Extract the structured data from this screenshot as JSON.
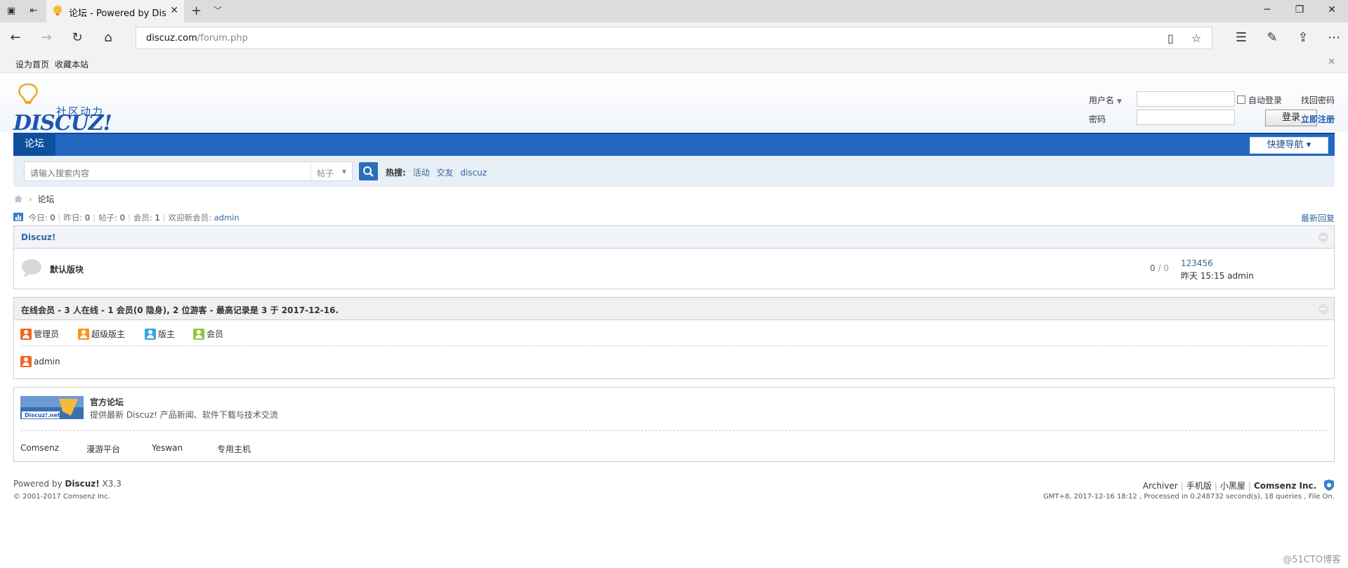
{
  "browser": {
    "tab_title": "论坛 - Powered by Discuz!",
    "url_host": "discuz.com",
    "url_path": "/forum.php",
    "favorites": [
      "设为首页",
      "收藏本站"
    ]
  },
  "header": {
    "slogan": "社区动力",
    "brand": "DISCUZ!",
    "login": {
      "username_label": "用户名",
      "password_label": "密码",
      "auto_login": "自动登录",
      "login_button": "登录",
      "forgot": "找回密码",
      "register": "立即注册"
    }
  },
  "nav": {
    "current": "论坛",
    "quick_nav": "快捷导航 ▾"
  },
  "search": {
    "placeholder": "请输入搜索内容",
    "type": "帖子",
    "hot_label": "热搜:",
    "hot": [
      "活动",
      "交友",
      "discuz"
    ]
  },
  "breadcrumb": {
    "sep": "›",
    "current": "论坛"
  },
  "stats": {
    "today_label": "今日:",
    "today": "0",
    "yesterday_label": "昨日:",
    "yesterday": "0",
    "posts_label": "帖子:",
    "posts": "0",
    "members_label": "会员:",
    "members": "1",
    "welcome_label": "欢迎新会员:",
    "welcome_user": "admin",
    "latest_reply": "最新回复"
  },
  "category": {
    "title": "Discuz!",
    "forum": {
      "name": "默认版块",
      "threads": "0",
      "posts": "0",
      "last_title": "123456",
      "last_time": "昨天 15:15 admin"
    }
  },
  "online": {
    "title": "在线会员 - 3 人在线 - 1 会员(0 隐身), 2 位游客 - 最高记录是 3 于 2017-12-16.",
    "legend": [
      "管理员",
      "超级版主",
      "版主",
      "会员"
    ],
    "users": [
      "admin"
    ]
  },
  "links": {
    "banner_text": "Discuz!.net",
    "title": "官方论坛",
    "desc": "提供最新 Discuz! 产品新闻、软件下载与技术交流",
    "items": [
      "Comsenz",
      "漫游平台",
      "Yeswan",
      "专用主机"
    ]
  },
  "footer": {
    "powered_prefix": "Powered by ",
    "powered_name": "Discuz!",
    "powered_ver": " X3.3",
    "copyright": "© 2001-2017 Comsenz Inc.",
    "links": [
      "Archiver",
      "手机版",
      "小黑屋"
    ],
    "company": "Comsenz Inc.",
    "info": "GMT+8, 2017-12-16 18:12 , Processed in 0.248732 second(s), 18 queries , File On."
  },
  "watermark": "@51CTO博客",
  "colors": {
    "nav_blue": "#2468c2",
    "link_blue": "#336699",
    "search_bg": "#e8eff7"
  }
}
